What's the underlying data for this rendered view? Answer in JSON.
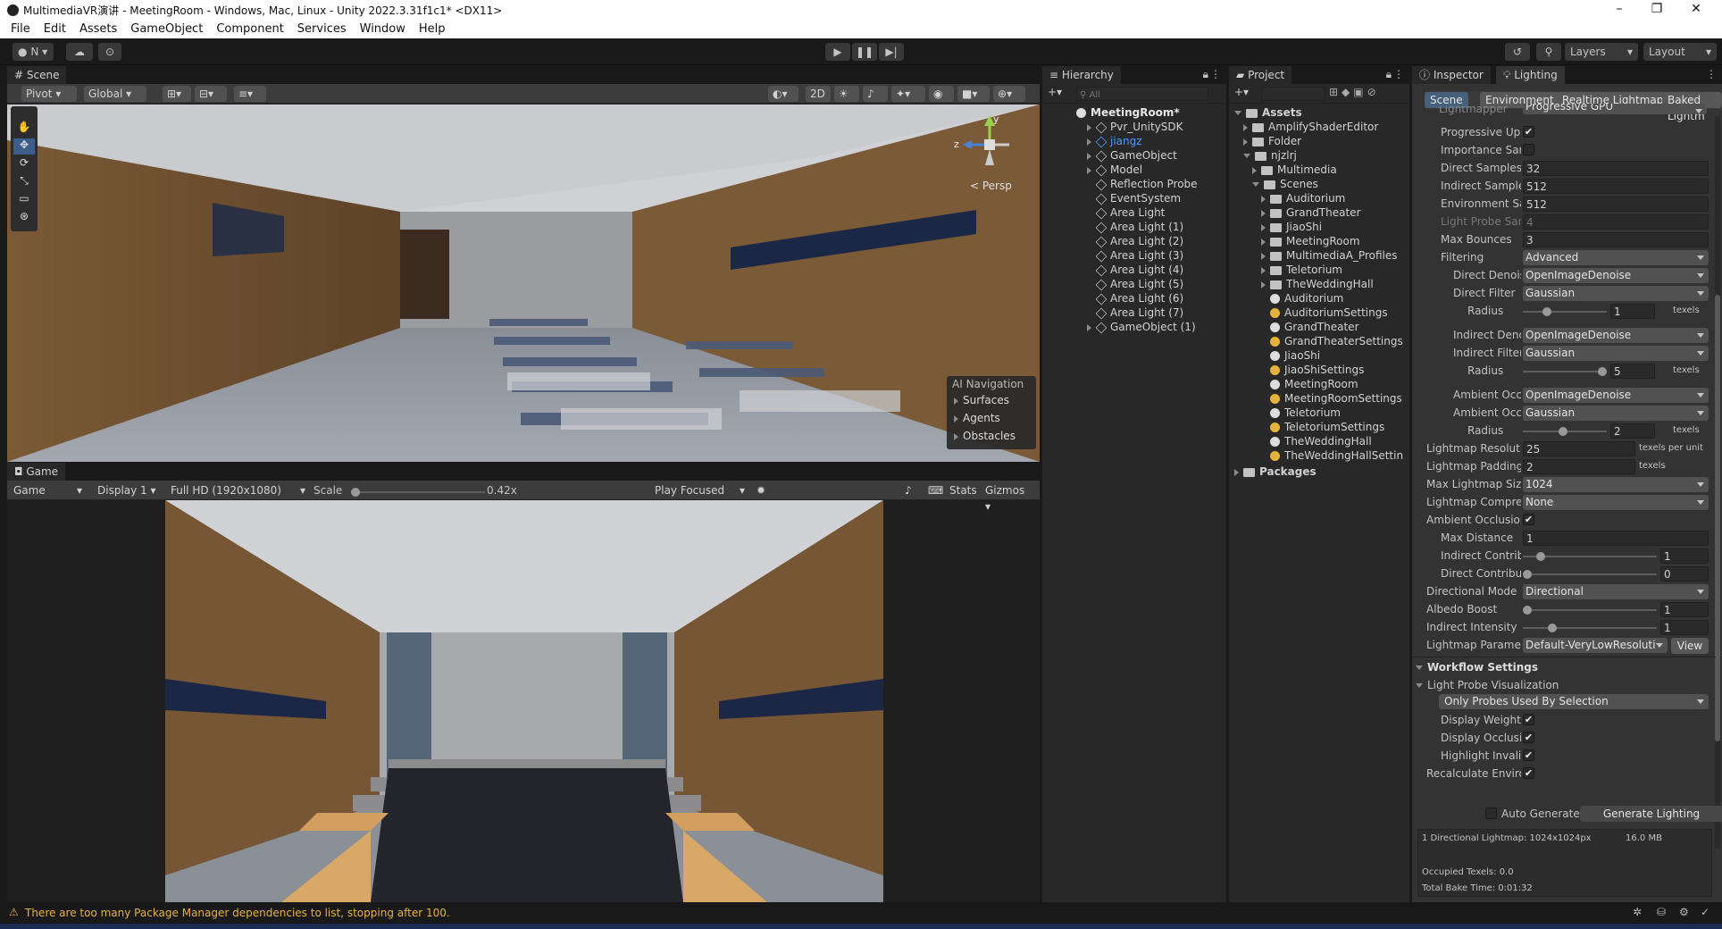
{
  "window": {
    "title": "MultimediaVR演讲 - MeetingRoom - Windows, Mac, Linux - Unity 2022.3.31f1c1* <DX11>",
    "minimize": "–",
    "maximize": "❐",
    "close": "✕"
  },
  "menu": [
    "File",
    "Edit",
    "Assets",
    "GameObject",
    "Component",
    "Services",
    "Window",
    "Help"
  ],
  "toolbar": {
    "account": "N",
    "layers": "Layers",
    "layout": "Layout"
  },
  "scene": {
    "tab": "Scene",
    "pivot": "Pivot",
    "global": "Global",
    "mode_2d": "2D",
    "persp": "< Persp",
    "gizmo_z": "z",
    "gizmo_y": "y",
    "overlay_title": "AI Navigation",
    "overlay_items": [
      "Surfaces",
      "Agents",
      "Obstacles"
    ]
  },
  "game": {
    "tab": "Game",
    "mode": "Game",
    "display": "Display 1",
    "resolution": "Full HD (1920x1080)",
    "scale_label": "Scale",
    "scale_value": "0.42x",
    "play_mode": "Play Focused",
    "stats": "Stats",
    "gizmos": "Gizmos"
  },
  "hierarchy": {
    "tab": "Hierarchy",
    "search_placeholder": "All",
    "root": "MeetingRoom*",
    "items": [
      "Pvr_UnitySDK",
      "jiangz",
      "GameObject",
      "Model",
      "Reflection Probe",
      "EventSystem",
      "Area Light",
      "Area Light (1)",
      "Area Light (2)",
      "Area Light (3)",
      "Area Light (4)",
      "Area Light (5)",
      "Area Light (6)",
      "Area Light (7)",
      "GameObject (1)"
    ]
  },
  "project": {
    "tab": "Project",
    "assets": "Assets",
    "folders": [
      "AmplifyShaderEditor",
      "Folder"
    ],
    "njzlrj": "njzlrj",
    "multimedia": "Multimedia",
    "scenes": "Scenes",
    "scene_folders": [
      "Auditorium",
      "GrandTheater",
      "JiaoShi",
      "MeetingRoom",
      "MultimediaA_Profiles",
      "Teletorium",
      "TheWeddingHall"
    ],
    "scene_files": [
      "Auditorium",
      "AuditoriumSettings",
      "GrandTheater",
      "GrandTheaterSettings",
      "JiaoShi",
      "JiaoShiSettings",
      "MeetingRoom",
      "MeetingRoomSettings",
      "Teletorium",
      "TeletoriumSettings",
      "TheWeddingHall",
      "TheWeddingHallSettin"
    ],
    "packages": "Packages"
  },
  "inspector": {
    "tab_inspector": "Inspector",
    "tab_lighting": "Lighting",
    "subtabs": [
      "Scene",
      "Environment",
      "Realtime Lightmaps",
      "Baked Lightm"
    ],
    "fields": {
      "cut_top": "Lightmapper",
      "cut_top_value": "Progressive GPU",
      "progressive": "Progressive Upc",
      "importance": "Importance Sam",
      "direct_samples": "Direct Samples",
      "direct_samples_v": "32",
      "indirect_samples": "Indirect Sample:",
      "indirect_samples_v": "512",
      "env_samples": "Environment Sa",
      "env_samples_v": "512",
      "lp_samples": "Light Probe Sam",
      "lp_samples_v": "4",
      "max_bounces": "Max Bounces",
      "max_bounces_v": "3",
      "filtering": "Filtering",
      "filtering_v": "Advanced",
      "direct_denoiser": "Direct Denois",
      "direct_denoiser_v": "OpenImageDenoise",
      "direct_filter": "Direct Filter",
      "direct_filter_v": "Gaussian",
      "radius": "Radius",
      "radius1_v": "1",
      "texels": "texels",
      "indirect_denoiser": "Indirect Deno",
      "indirect_denoiser_v": "OpenImageDenoise",
      "indirect_filter": "Indirect Filter",
      "indirect_filter_v": "Gaussian",
      "radius2_v": "5",
      "ambient_den": "Ambient Occl",
      "ambient_den_v": "OpenImageDenoise",
      "ambient_filter": "Ambient Occl",
      "ambient_filter_v": "Gaussian",
      "radius3_v": "2",
      "lm_res": "Lightmap Resolutic",
      "lm_res_v": "25",
      "texels_per_unit": "texels per unit",
      "lm_pad": "Lightmap Padding",
      "lm_pad_v": "2",
      "max_lm": "Max Lightmap Size",
      "max_lm_v": "1024",
      "lm_comp": "Lightmap Compres",
      "lm_comp_v": "None",
      "ao": "Ambient Occlusion",
      "max_dist": "Max Distance",
      "max_dist_v": "1",
      "ind_contrib": "Indirect Contribu",
      "ind_contrib_v": "1",
      "dir_contrib": "Direct Contribut",
      "dir_contrib_v": "0",
      "dir_mode": "Directional Mode",
      "dir_mode_v": "Directional",
      "albedo": "Albedo Boost",
      "albedo_v": "1",
      "ind_int": "Indirect Intensity",
      "ind_int_v": "1",
      "lm_params": "Lightmap Paramet",
      "lm_params_v": "Default-VeryLowResoluti",
      "view": "View"
    },
    "workflow": "Workflow Settings",
    "lpv": "Light Probe Visualization",
    "lpv_v": "Only Probes Used By Selection",
    "disp_weights": "Display Weights",
    "disp_occ": "Display Occlusi",
    "highlight": "Highlight Invalid",
    "recalc": "Recalculate Enviro",
    "auto_gen": "Auto Generate",
    "gen_light": "Generate Lighting",
    "info1": "1 Directional Lightmap: 1024x1024px",
    "info1_size": "16.0 MB",
    "info2": "Occupied Texels: 0.0",
    "info3": "Total Bake Time: 0:01:32"
  },
  "status": {
    "warning": "There are too many Package Manager dependencies to list, stopping after 100."
  }
}
